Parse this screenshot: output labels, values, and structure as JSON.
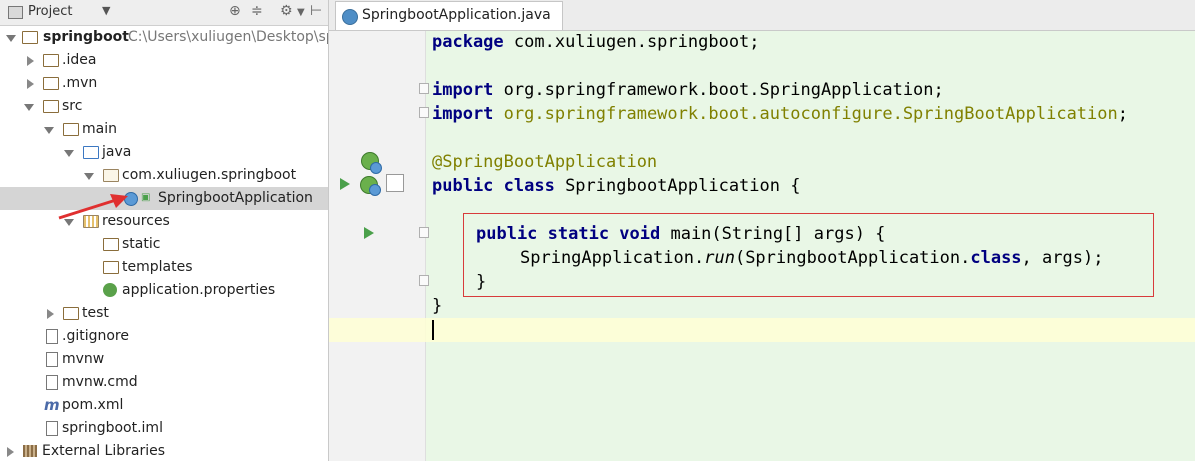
{
  "left_panel": {
    "title": "Project",
    "tree": [
      {
        "label": "springboot",
        "path": "C:\\Users\\xuliugen\\Desktop\\sp"
      },
      {
        "label": ".idea"
      },
      {
        "label": ".mvn"
      },
      {
        "label": "src"
      },
      {
        "label": "main"
      },
      {
        "label": "java"
      },
      {
        "label": "com.xuliugen.springboot"
      },
      {
        "label": "SpringbootApplication"
      },
      {
        "label": "resources"
      },
      {
        "label": "static"
      },
      {
        "label": "templates"
      },
      {
        "label": "application.properties"
      },
      {
        "label": "test"
      },
      {
        "label": ".gitignore"
      },
      {
        "label": "mvnw"
      },
      {
        "label": "mvnw.cmd"
      },
      {
        "label": "pom.xml"
      },
      {
        "label": "springboot.iml"
      },
      {
        "label": "External Libraries"
      }
    ]
  },
  "editor": {
    "tab_label": "SpringbootApplication.java",
    "lines": {
      "l1_kw": "package",
      "l1_rest": " com.xuliugen.springboot;",
      "l3_kw": "import",
      "l3_rest": " org.springframework.boot.SpringApplication;",
      "l4_kw": "import",
      "l4_pkg": " org.springframework.boot.autoconfigure.SpringBootApplication",
      "l4_end": ";",
      "l6_ann": "@SpringBootApplication",
      "l7_kw": "public class",
      "l7_rest": " SpringbootApplication {",
      "l9_kw": "public static void",
      "l9_rest": " main(String[] args) {",
      "l10_a": "SpringApplication.",
      "l10_it": "run",
      "l10_b": "(SpringbootApplication.",
      "l10_kw": "class",
      "l10_c": ", args);",
      "l11": "}",
      "l12": "}"
    }
  },
  "colors": {
    "keyword": "#000080",
    "annotation": "#808000",
    "editor_bg": "#e9f7e6",
    "highlight_box": "#d83b3b"
  }
}
